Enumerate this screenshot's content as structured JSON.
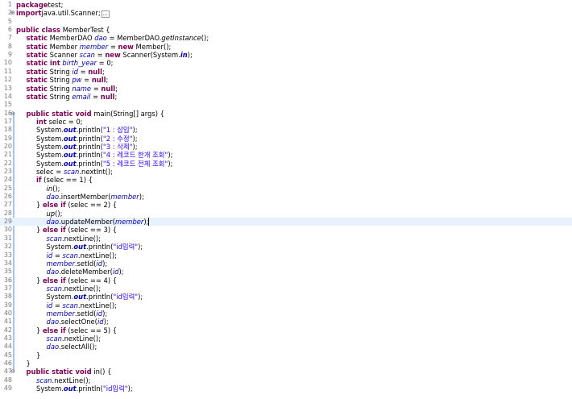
{
  "editor": {
    "current_line": 29,
    "lines": [
      {
        "n": "1",
        "fold": "",
        "indent": 0,
        "tokens": [
          [
            "kw",
            "package"
          ],
          [
            "",
            "test"
          ],
          [
            "",
            ";"
          ]
        ]
      },
      {
        "n": "2",
        "fold": "⊕",
        "indent": 0,
        "tokens": [
          [
            "kw",
            "import"
          ],
          [
            "",
            "java.util.Scanner;"
          ],
          [
            "collapsed",
            "…"
          ]
        ]
      },
      {
        "n": "5",
        "fold": "",
        "indent": 0,
        "tokens": []
      },
      {
        "n": "6",
        "fold": "",
        "indent": 0,
        "tokens": [
          [
            "kw",
            "public"
          ],
          [
            "kw",
            " class"
          ],
          [
            "",
            " MemberTest {"
          ]
        ]
      },
      {
        "n": "7",
        "fold": "",
        "indent": 1,
        "tokens": [
          [
            "kw",
            "static"
          ],
          [
            "",
            " MemberDAO "
          ],
          [
            "fld",
            "dao"
          ],
          [
            "",
            " = MemberDAO."
          ],
          [
            "sm",
            "getInstance"
          ],
          [
            "",
            "();"
          ]
        ]
      },
      {
        "n": "8",
        "fold": "",
        "indent": 1,
        "tokens": [
          [
            "kw",
            "static"
          ],
          [
            "",
            " Member "
          ],
          [
            "fld",
            "member"
          ],
          [
            "",
            " = "
          ],
          [
            "kw",
            "new"
          ],
          [
            "",
            " Member();"
          ]
        ]
      },
      {
        "n": "9",
        "fold": "",
        "indent": 1,
        "tokens": [
          [
            "kw",
            "static"
          ],
          [
            "",
            " Scanner "
          ],
          [
            "fld",
            "scan"
          ],
          [
            "",
            " = "
          ],
          [
            "kw",
            "new"
          ],
          [
            "",
            " Scanner(System."
          ],
          [
            "stf",
            "in"
          ],
          [
            "",
            ");"
          ]
        ]
      },
      {
        "n": "10",
        "fold": "",
        "indent": 1,
        "tokens": [
          [
            "kw",
            "static"
          ],
          [
            "kw",
            " int"
          ],
          [
            "",
            " "
          ],
          [
            "fld",
            "birth_year"
          ],
          [
            "",
            " = 0;"
          ]
        ]
      },
      {
        "n": "11",
        "fold": "",
        "indent": 1,
        "tokens": [
          [
            "kw",
            "static"
          ],
          [
            "",
            " String "
          ],
          [
            "fld",
            "id"
          ],
          [
            "",
            " = "
          ],
          [
            "kw",
            "null"
          ],
          [
            "",
            ";"
          ]
        ]
      },
      {
        "n": "12",
        "fold": "",
        "indent": 1,
        "tokens": [
          [
            "kw",
            "static"
          ],
          [
            "",
            " String "
          ],
          [
            "fld",
            "pw"
          ],
          [
            "",
            " = "
          ],
          [
            "kw",
            "null"
          ],
          [
            "",
            ";"
          ]
        ]
      },
      {
        "n": "13",
        "fold": "",
        "indent": 1,
        "tokens": [
          [
            "kw",
            "static"
          ],
          [
            "",
            " String "
          ],
          [
            "fld",
            "name"
          ],
          [
            "",
            " = "
          ],
          [
            "kw",
            "null"
          ],
          [
            "",
            ";"
          ]
        ]
      },
      {
        "n": "14",
        "fold": "",
        "indent": 1,
        "tokens": [
          [
            "kw",
            "static"
          ],
          [
            "",
            " String "
          ],
          [
            "fld",
            "email"
          ],
          [
            "",
            " = "
          ],
          [
            "kw",
            "null"
          ],
          [
            "",
            ";"
          ]
        ]
      },
      {
        "n": "15",
        "fold": "",
        "indent": 0,
        "tokens": []
      },
      {
        "n": "16",
        "fold": "⊖",
        "indent": 1,
        "tokens": [
          [
            "kw",
            "public"
          ],
          [
            "kw",
            " static"
          ],
          [
            "kw",
            " void"
          ],
          [
            "",
            " main(String[] args) {"
          ]
        ]
      },
      {
        "n": "17",
        "fold": "",
        "indent": 2,
        "tokens": [
          [
            "kw",
            "int"
          ],
          [
            "",
            " selec = 0;"
          ]
        ]
      },
      {
        "n": "18",
        "fold": "",
        "indent": 2,
        "tokens": [
          [
            "",
            "System."
          ],
          [
            "stf",
            "out"
          ],
          [
            "",
            ".println("
          ],
          [
            "str",
            "\"1 : 삽입\""
          ],
          [
            "",
            ");"
          ]
        ]
      },
      {
        "n": "19",
        "fold": "",
        "indent": 2,
        "tokens": [
          [
            "",
            "System."
          ],
          [
            "stf",
            "out"
          ],
          [
            "",
            ".println("
          ],
          [
            "str",
            "\"2 : 수정\""
          ],
          [
            "",
            ");"
          ]
        ]
      },
      {
        "n": "20",
        "fold": "",
        "indent": 2,
        "tokens": [
          [
            "",
            "System."
          ],
          [
            "stf",
            "out"
          ],
          [
            "",
            ".println("
          ],
          [
            "str",
            "\"3 : 삭제\""
          ],
          [
            "",
            ");"
          ]
        ]
      },
      {
        "n": "21",
        "fold": "",
        "indent": 2,
        "tokens": [
          [
            "",
            "System."
          ],
          [
            "stf",
            "out"
          ],
          [
            "",
            ".println("
          ],
          [
            "str",
            "\"4 : 레코드 한개 조회\""
          ],
          [
            "",
            ");"
          ]
        ]
      },
      {
        "n": "22",
        "fold": "",
        "indent": 2,
        "tokens": [
          [
            "",
            "System."
          ],
          [
            "stf",
            "out"
          ],
          [
            "",
            ".println("
          ],
          [
            "str",
            "\"5 : 레코드 전체 조회\""
          ],
          [
            "",
            ");"
          ]
        ]
      },
      {
        "n": "23",
        "fold": "",
        "indent": 2,
        "tokens": [
          [
            "",
            "selec = "
          ],
          [
            "fld",
            "scan"
          ],
          [
            "",
            ".nextInt();"
          ]
        ]
      },
      {
        "n": "24",
        "fold": "",
        "indent": 2,
        "tokens": [
          [
            "kw",
            "if"
          ],
          [
            "",
            " (selec == 1) {"
          ]
        ]
      },
      {
        "n": "25",
        "fold": "",
        "indent": 3,
        "tokens": [
          [
            "sm",
            "in"
          ],
          [
            "",
            "();"
          ]
        ]
      },
      {
        "n": "26",
        "fold": "",
        "indent": 3,
        "tokens": [
          [
            "fld",
            "dao"
          ],
          [
            "",
            ".insertMember("
          ],
          [
            "fld",
            "member"
          ],
          [
            "",
            ");"
          ]
        ]
      },
      {
        "n": "27",
        "fold": "",
        "indent": 2,
        "tokens": [
          [
            "",
            "} "
          ],
          [
            "kw",
            "else"
          ],
          [
            "kw",
            " if"
          ],
          [
            "",
            " (selec == 2) {"
          ]
        ]
      },
      {
        "n": "28",
        "fold": "",
        "indent": 3,
        "tokens": [
          [
            "sm",
            "up"
          ],
          [
            "",
            "();"
          ]
        ]
      },
      {
        "n": "29",
        "fold": "",
        "indent": 3,
        "tokens": [
          [
            "fld",
            "dao"
          ],
          [
            "",
            ".updateMember("
          ],
          [
            "fld",
            "member"
          ],
          [
            "",
            ")"
          ],
          [
            "caret",
            ";"
          ]
        ]
      },
      {
        "n": "30",
        "fold": "",
        "indent": 2,
        "tokens": [
          [
            "",
            "} "
          ],
          [
            "kw",
            "else"
          ],
          [
            "kw",
            " if"
          ],
          [
            "",
            " (selec == 3) {"
          ]
        ]
      },
      {
        "n": "31",
        "fold": "",
        "indent": 3,
        "tokens": [
          [
            "fld",
            "scan"
          ],
          [
            "",
            ".nextLine();"
          ]
        ]
      },
      {
        "n": "32",
        "fold": "",
        "indent": 3,
        "tokens": [
          [
            "",
            "System."
          ],
          [
            "stf",
            "out"
          ],
          [
            "",
            ".println("
          ],
          [
            "str",
            "\"id입력\""
          ],
          [
            "",
            ");"
          ]
        ]
      },
      {
        "n": "33",
        "fold": "",
        "indent": 3,
        "tokens": [
          [
            "fld",
            "id"
          ],
          [
            "",
            " = "
          ],
          [
            "fld",
            "scan"
          ],
          [
            "",
            ".nextLine();"
          ]
        ]
      },
      {
        "n": "34",
        "fold": "",
        "indent": 3,
        "tokens": [
          [
            "fld",
            "member"
          ],
          [
            "",
            ".setId("
          ],
          [
            "fld",
            "id"
          ],
          [
            "",
            ");"
          ]
        ]
      },
      {
        "n": "35",
        "fold": "",
        "indent": 3,
        "tokens": [
          [
            "fld",
            "dao"
          ],
          [
            "",
            ".deleteMember("
          ],
          [
            "fld",
            "id"
          ],
          [
            "",
            ");"
          ]
        ]
      },
      {
        "n": "36",
        "fold": "",
        "indent": 2,
        "tokens": [
          [
            "",
            "} "
          ],
          [
            "kw",
            "else"
          ],
          [
            "kw",
            " if"
          ],
          [
            "",
            " (selec == 4) {"
          ]
        ]
      },
      {
        "n": "37",
        "fold": "",
        "indent": 3,
        "tokens": [
          [
            "fld",
            "scan"
          ],
          [
            "",
            ".nextLine();"
          ]
        ]
      },
      {
        "n": "38",
        "fold": "",
        "indent": 3,
        "tokens": [
          [
            "",
            "System."
          ],
          [
            "stf",
            "out"
          ],
          [
            "",
            ".println("
          ],
          [
            "str",
            "\"id입력\""
          ],
          [
            "",
            ");"
          ]
        ]
      },
      {
        "n": "39",
        "fold": "",
        "indent": 3,
        "tokens": [
          [
            "fld",
            "id"
          ],
          [
            "",
            " = "
          ],
          [
            "fld",
            "scan"
          ],
          [
            "",
            ".nextLine();"
          ]
        ]
      },
      {
        "n": "40",
        "fold": "",
        "indent": 3,
        "tokens": [
          [
            "fld",
            "member"
          ],
          [
            "",
            ".setId("
          ],
          [
            "fld",
            "id"
          ],
          [
            "",
            ");"
          ]
        ]
      },
      {
        "n": "41",
        "fold": "",
        "indent": 3,
        "tokens": [
          [
            "fld",
            "dao"
          ],
          [
            "",
            ".selectOne("
          ],
          [
            "fld",
            "id"
          ],
          [
            "",
            ");"
          ]
        ]
      },
      {
        "n": "42",
        "fold": "",
        "indent": 2,
        "tokens": [
          [
            "",
            "} "
          ],
          [
            "kw",
            "else"
          ],
          [
            "kw",
            " if"
          ],
          [
            "",
            " (selec == 5) {"
          ]
        ]
      },
      {
        "n": "43",
        "fold": "",
        "indent": 3,
        "tokens": [
          [
            "fld",
            "scan"
          ],
          [
            "",
            ".nextLine();"
          ]
        ]
      },
      {
        "n": "44",
        "fold": "",
        "indent": 3,
        "tokens": [
          [
            "fld",
            "dao"
          ],
          [
            "",
            ".selectAll();"
          ]
        ]
      },
      {
        "n": "45",
        "fold": "",
        "indent": 2,
        "tokens": [
          [
            "",
            "}"
          ]
        ]
      },
      {
        "n": "46",
        "fold": "",
        "indent": 1,
        "tokens": [
          [
            "",
            "}"
          ]
        ]
      },
      {
        "n": "47",
        "fold": "⊖",
        "indent": 1,
        "tokens": [
          [
            "kw",
            "public"
          ],
          [
            "kw",
            " static"
          ],
          [
            "kw",
            " void"
          ],
          [
            "",
            " in() {"
          ]
        ]
      },
      {
        "n": "48",
        "fold": "",
        "indent": 2,
        "tokens": [
          [
            "fld",
            "scan"
          ],
          [
            "",
            ".nextLine();"
          ]
        ]
      },
      {
        "n": "49",
        "fold": "",
        "indent": 2,
        "tokens": [
          [
            "",
            "System."
          ],
          [
            "stf",
            "out"
          ],
          [
            "",
            ".println("
          ],
          [
            "str",
            "\"id입력\""
          ],
          [
            "",
            ");"
          ]
        ]
      }
    ]
  }
}
